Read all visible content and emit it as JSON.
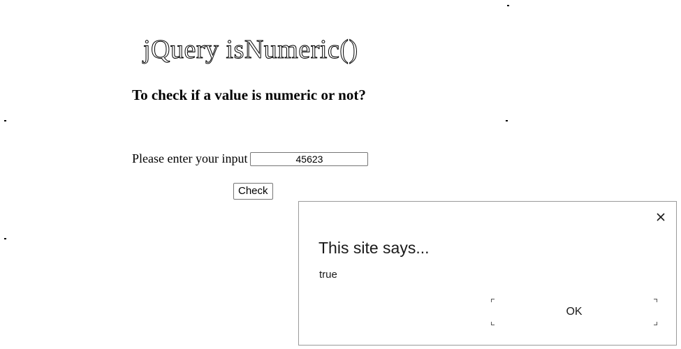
{
  "page": {
    "title": "jQuery isNumeric()",
    "subtitle": "To check if a value is numeric or not?",
    "input_label": "Please enter your input",
    "input_value": "45623",
    "check_button_label": "Check"
  },
  "dialog": {
    "title": "This site says...",
    "message": "true",
    "ok_label": "OK",
    "close_icon": "close-icon"
  },
  "colors": {
    "background": "#ffffff",
    "text": "#000000",
    "dialog_border": "#9a9a9a",
    "input_border": "#767676"
  }
}
